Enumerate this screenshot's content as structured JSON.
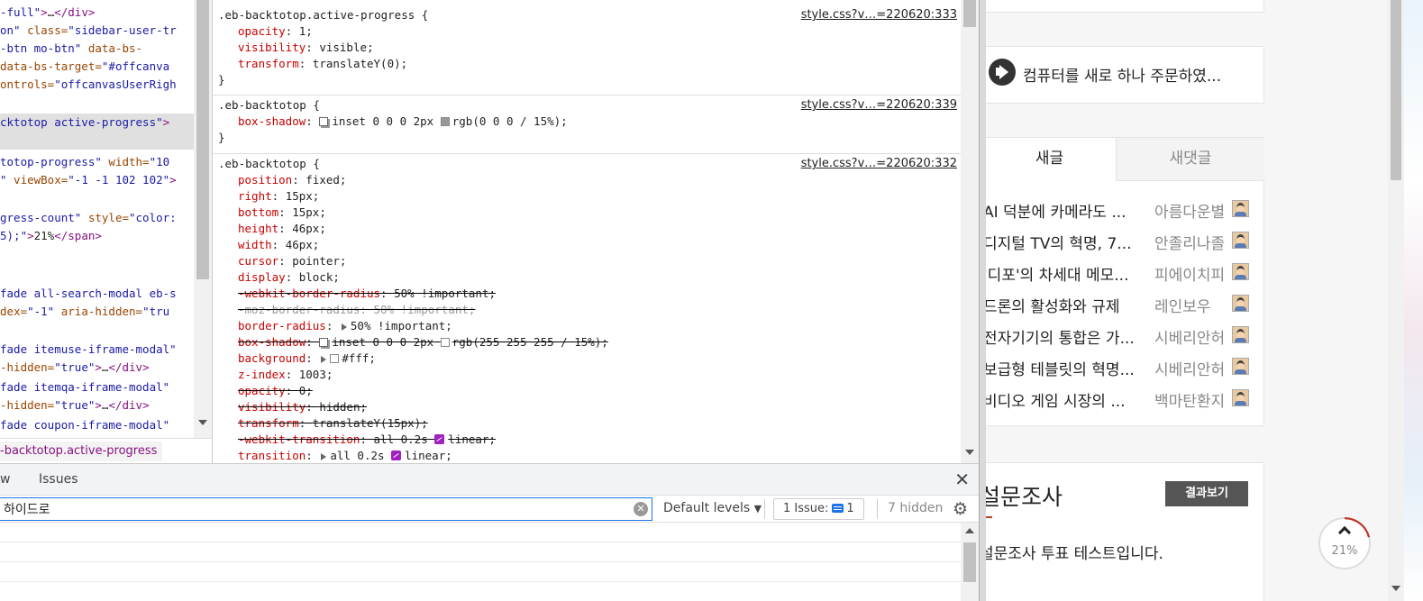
{
  "elements_panel": {
    "lines": [
      {
        "parts": [
          [
            "t-val",
            "-full\""
          ],
          [
            "t-tag",
            ">"
          ],
          [
            "t-text",
            "…"
          ],
          [
            "t-tag",
            "</div>"
          ]
        ]
      },
      {
        "parts": [
          [
            "t-val",
            "on\""
          ],
          [
            "t-attr",
            " class="
          ],
          [
            "t-val",
            "\"sidebar-user-tr"
          ]
        ]
      },
      {
        "parts": [
          [
            "t-val",
            "-btn mo-btn\""
          ],
          [
            "t-attr",
            " data-bs-"
          ]
        ]
      },
      {
        "parts": [
          [
            "t-attr",
            " data-bs-target="
          ],
          [
            "t-val",
            "\"#offcanva"
          ]
        ]
      },
      {
        "parts": [
          [
            "t-attr",
            "ontrols="
          ],
          [
            "t-val",
            "\"offcanvasUserRigh"
          ]
        ]
      },
      {
        "parts": []
      },
      {
        "parts": [
          [
            "t-val",
            "cktotop active-progress\""
          ],
          [
            "t-tag",
            ">"
          ]
        ],
        "selected": true
      },
      {
        "parts": []
      },
      {
        "parts": [
          [
            "t-val",
            "totop-progress\""
          ],
          [
            "t-attr",
            " width="
          ],
          [
            "t-val",
            "\"10"
          ]
        ]
      },
      {
        "parts": [
          [
            "t-val",
            "\""
          ],
          [
            "t-attr",
            " viewBox="
          ],
          [
            "t-val",
            "\"-1 -1 102 102\""
          ],
          [
            "t-tag",
            ">"
          ]
        ]
      },
      {
        "parts": []
      },
      {
        "parts": [
          [
            "t-val",
            "gress-count\""
          ],
          [
            "t-attr",
            " style="
          ],
          [
            "t-val",
            "\"color:"
          ]
        ]
      },
      {
        "parts": [
          [
            "t-val",
            "5);\""
          ],
          [
            "t-tag",
            ">"
          ],
          [
            "t-text",
            "21%"
          ],
          [
            "t-tag",
            "</span>"
          ]
        ]
      },
      {
        "parts": []
      },
      {
        "parts": []
      },
      {
        "parts": [
          [
            "t-val",
            "fade all-search-modal eb-s"
          ]
        ]
      },
      {
        "parts": [
          [
            "t-attr",
            "dex="
          ],
          [
            "t-val",
            "\"-1\""
          ],
          [
            "t-attr",
            " aria-hidden="
          ],
          [
            "t-val",
            "\"tru"
          ]
        ]
      },
      {
        "parts": []
      },
      {
        "parts": [
          [
            "t-val",
            "fade itemuse-iframe-modal\""
          ]
        ]
      },
      {
        "parts": [
          [
            "t-attr",
            "-hidden="
          ],
          [
            "t-val",
            "\"true\""
          ],
          [
            "t-tag",
            ">"
          ],
          [
            "t-text",
            "…"
          ],
          [
            "t-tag",
            "</div>"
          ]
        ]
      },
      {
        "parts": [
          [
            "t-val",
            "fade itemqa-iframe-modal\""
          ]
        ]
      },
      {
        "parts": [
          [
            "t-attr",
            "-hidden="
          ],
          [
            "t-val",
            "\"true\""
          ],
          [
            "t-tag",
            ">"
          ],
          [
            "t-text",
            "…"
          ],
          [
            "t-tag",
            "</div>"
          ]
        ]
      },
      {
        "parts": [
          [
            "t-val",
            "fade coupon-iframe-modal\""
          ]
        ]
      }
    ],
    "breadcrumb": "-backtotop.active-progress"
  },
  "styles_panel": {
    "rules": [
      {
        "selector": ".eb-backtotop.active-progress {",
        "source": "style.css?v…=220620:333",
        "props": [
          {
            "name": "opacity",
            "value": "1;"
          },
          {
            "name": "visibility",
            "value": "visible;"
          },
          {
            "name": "transform",
            "value": "translateY(0);"
          }
        ]
      },
      {
        "selector": ".eb-backtotop {",
        "source": "style.css?v…=220620:339",
        "props": [
          {
            "name": "box-shadow",
            "value": "inset 0 0 0 2px",
            "shadow_icon": true,
            "swatch": "#999999",
            "value2": "rgb(0 0 0 / 15%);"
          }
        ]
      },
      {
        "selector": ".eb-backtotop {",
        "source": "style.css?v…=220620:332",
        "props": [
          {
            "name": "position",
            "value": "fixed;"
          },
          {
            "name": "right",
            "value": "15px;"
          },
          {
            "name": "bottom",
            "value": "15px;"
          },
          {
            "name": "height",
            "value": "46px;"
          },
          {
            "name": "width",
            "value": "46px;"
          },
          {
            "name": "cursor",
            "value": "pointer;"
          },
          {
            "name": "display",
            "value": "block;"
          },
          {
            "name": "-webkit-border-radius",
            "value": "50% !important;",
            "struck": true
          },
          {
            "name": "-moz-border-radius",
            "value": "50% !important;",
            "struck": true,
            "gray": true
          },
          {
            "name": "border-radius",
            "value": "50% !important;",
            "expand": true
          },
          {
            "name": "box-shadow",
            "value": "inset 0 0 0 2px",
            "shadow_icon": true,
            "swatch": "#ffffff",
            "value2": "rgb(255 255 255 / 15%);",
            "struck": true
          },
          {
            "name": "background",
            "value": "#fff;",
            "expand": true,
            "swatch": "#ffffff"
          },
          {
            "name": "z-index",
            "value": "1003;"
          },
          {
            "name": "opacity",
            "value": "0;",
            "struck": true
          },
          {
            "name": "visibility",
            "value": "hidden;",
            "struck": true
          },
          {
            "name": "transform",
            "value": "translateY(15px);",
            "struck": true
          },
          {
            "name": "-webkit-transition",
            "value": "all 0.2s",
            "ease_icon": true,
            "value2": "linear;",
            "struck": true
          },
          {
            "name": "transition",
            "value": "all 0.2s",
            "expand": true,
            "ease_icon": true,
            "value2": "linear;"
          }
        ]
      }
    ]
  },
  "drawer": {
    "tabs": [
      "w",
      "Issues"
    ],
    "close_symbol": "✕",
    "filter_value": "하이드로",
    "levels_label": "Default levels",
    "issue_label": "1 Issue:",
    "issue_count": "1",
    "hidden_label": "7 hidden",
    "gear_icon": "gear-icon"
  },
  "site": {
    "notice": "컴퓨터를 새로 하나 주문하였...",
    "post_tabs": [
      "새글",
      "새댓글"
    ],
    "posts": [
      {
        "title": "AI 덕분에 카메라도 ...",
        "author": "아름다운별"
      },
      {
        "title": "디지털 TV의 혁명, 7...",
        "author": "안졸리나졸"
      },
      {
        "title": "'디포'의 차세대 메모...",
        "author": "피에이치피"
      },
      {
        "title": "드론의 활성화와 규제",
        "author": "레인보우"
      },
      {
        "title": "전자기기의 통합은 가...",
        "author": "시베리안허"
      },
      {
        "title": "보급형 테블릿의 혁명...",
        "author": "시베리안허"
      },
      {
        "title": "비디오 게임 시장의 ...",
        "author": "백마탄환지"
      }
    ],
    "poll": {
      "title": "설문조사",
      "result_button": "결과보기",
      "description": "설문조사 투표 테스트입니다."
    },
    "progress": {
      "count_text": "21%",
      "fraction": 0.21
    },
    "accent": "#c0392b"
  }
}
